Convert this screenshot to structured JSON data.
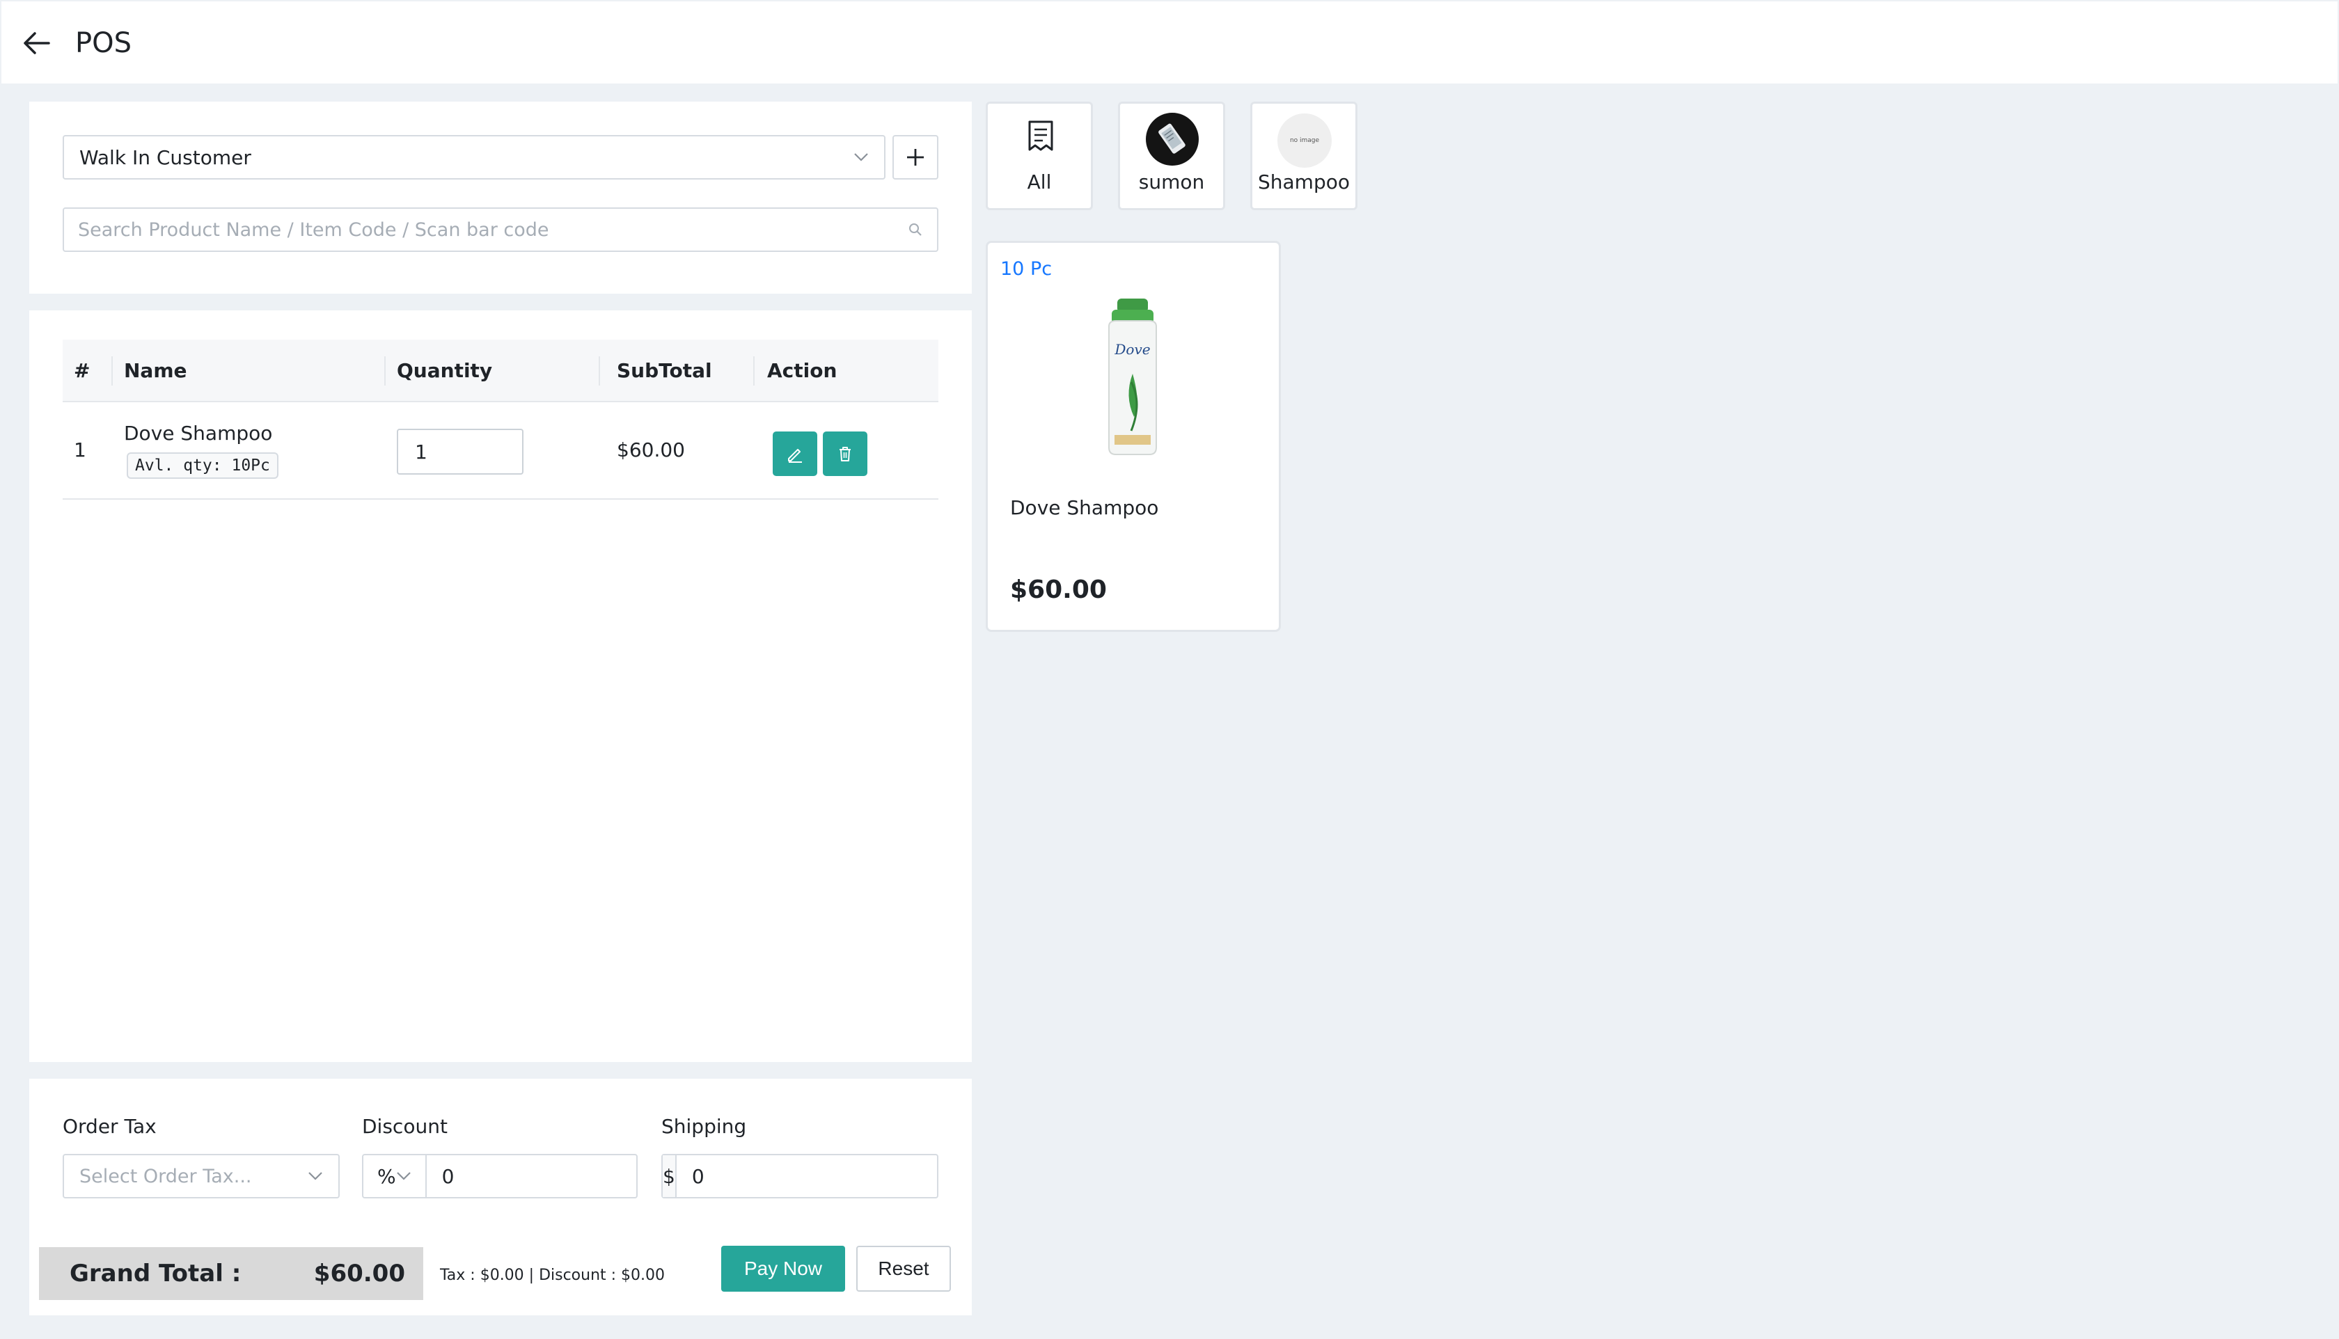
{
  "header": {
    "title": "POS"
  },
  "customer": {
    "selected": "Walk In Customer"
  },
  "search": {
    "placeholder": "Search Product Name / Item Code / Scan bar code",
    "value": ""
  },
  "cart": {
    "columns": {
      "index": "#",
      "name": "Name",
      "quantity": "Quantity",
      "subtotal": "SubTotal",
      "action": "Action"
    },
    "items": [
      {
        "index": "1",
        "name": "Dove Shampoo",
        "available": "Avl. qty: 10Pc",
        "quantity": "1",
        "subtotal": "$60.00"
      }
    ]
  },
  "summary": {
    "order_tax_label": "Order Tax",
    "order_tax_placeholder": "Select Order Tax...",
    "discount_label": "Discount",
    "discount_type": "%",
    "discount_value": "0",
    "shipping_label": "Shipping",
    "shipping_prefix": "$",
    "shipping_value": "0"
  },
  "footer": {
    "grand_total_label": "Grand Total :",
    "grand_total_value": "$60.00",
    "tax_discount": "Tax : $0.00 | Discount : $0.00",
    "pay_label": "Pay Now",
    "reset_label": "Reset"
  },
  "categories": [
    {
      "label": "All",
      "icon": "receipt-icon"
    },
    {
      "label": "sumon",
      "icon": "category-image"
    },
    {
      "label": "Shampoo",
      "icon": "no-image-placeholder",
      "image_text": "no image"
    }
  ],
  "products": [
    {
      "stock": "10 Pc",
      "name": "Dove Shampoo",
      "price": "$60.00"
    }
  ],
  "colors": {
    "accent": "#26a69a",
    "stock": "#1677ff",
    "background": "#edf1f5"
  }
}
